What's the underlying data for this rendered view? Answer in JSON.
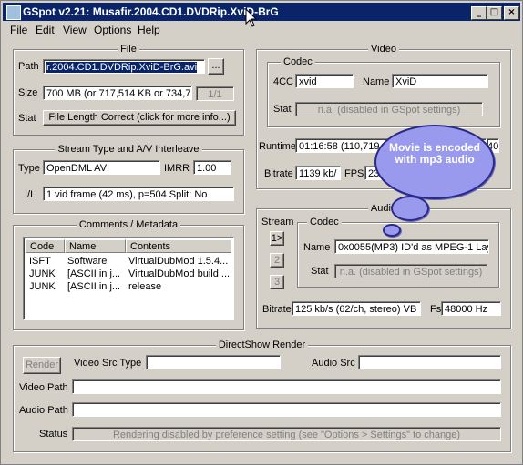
{
  "window": {
    "title": "GSpot v2.21: Musafir.2004.CD1.DVDRip.XviD-BrG"
  },
  "menu": [
    "File",
    "Edit",
    "View",
    "Options",
    "Help"
  ],
  "file": {
    "group_title": "File",
    "path_label": "Path",
    "path_value": "r.2004.CD1.DVDRip.XviD-BrG.avi",
    "browse_label": "...",
    "size_label": "Size",
    "size_value": "700 MB (or 717,514 KB or 734,73",
    "part_value": "1/1",
    "stat_label": "Stat",
    "stat_button": "File Length Correct (click for more info...)"
  },
  "stream": {
    "group_title": "Stream Type and A/V Interleave",
    "type_label": "Type",
    "type_value": "OpenDML AVI",
    "imrr_label": "IMRR",
    "imrr_value": "1.00",
    "il_label": "I/L",
    "il_value": "1 vid frame (42 ms), p=504  Split: No"
  },
  "comments": {
    "group_title": "Comments / Metadata",
    "headers": [
      "Code",
      "Name",
      "Contents"
    ],
    "rows": [
      [
        "ISFT",
        "Software",
        "VirtualDubMod 1.5.4..."
      ],
      [
        "JUNK",
        "[ASCII in j...",
        "VirtualDubMod build ..."
      ],
      [
        "JUNK",
        "[ASCII in j...",
        "release"
      ]
    ]
  },
  "video": {
    "group_title": "Video",
    "codec_title": "Codec",
    "fourcc_label": "4CC",
    "fourcc_value": "xvid",
    "name_label": "Name",
    "name_value": "XviD",
    "stat_label": "Stat",
    "stat_value": "n.a. (disabled in GSpot settings)",
    "runtime_label": "Runtime",
    "runtime_value": "01:16:58 (110,719",
    "runtime_extra": "40",
    "bitrate_label": "Bitrate",
    "bitrate_value": "1139 kb/",
    "fps_label": "FPS",
    "fps_value": "23"
  },
  "audio": {
    "group_title": "Audio",
    "stream_label": "Stream",
    "stream_buttons": [
      "1>",
      "2",
      "3"
    ],
    "codec_title": "Codec",
    "name_label": "Name",
    "name_value": "0x0055(MP3) ID'd as MPEG-1 Lay",
    "stat_label": "Stat",
    "stat_value": "n.a. (disabled in GSpot settings)",
    "bitrate_label": "Bitrate",
    "bitrate_value": "125 kb/s (62/ch, stereo) VB",
    "fs_label": "Fs",
    "fs_value": "48000 Hz"
  },
  "callout": {
    "text": "Movie is encoded with mp3 audio"
  },
  "render": {
    "group_title": "DirectShow Render",
    "render_button": "Render",
    "video_src_type_label": "Video Src Type",
    "audio_src_label": "Audio Src",
    "video_path_label": "Video Path",
    "audio_path_label": "Audio Path",
    "status_label": "Status",
    "status_value": "Rendering disabled by preference setting (see \"Options > Settings\" to change)"
  }
}
